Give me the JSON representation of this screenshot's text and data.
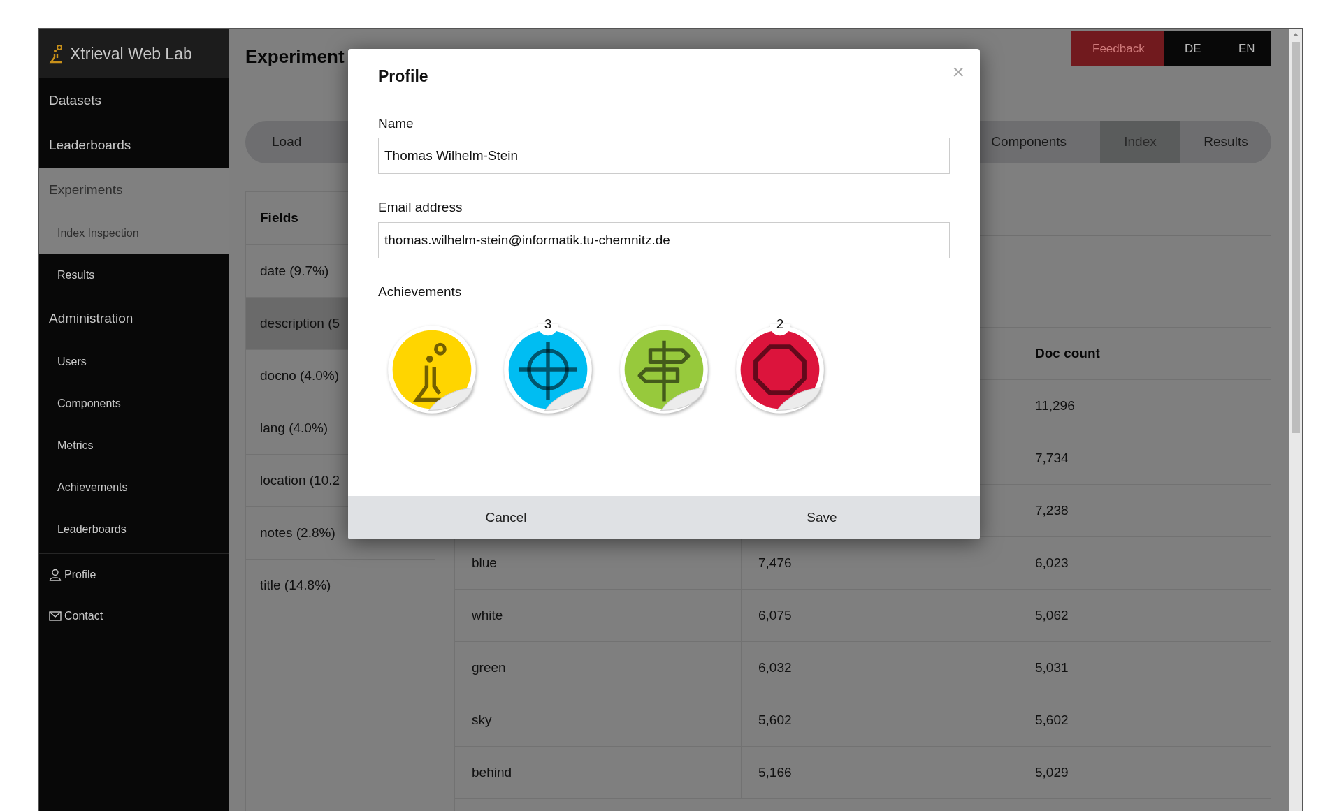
{
  "app": {
    "title": "Xtrieval Web Lab"
  },
  "sidebar": {
    "items": [
      {
        "label": "Datasets",
        "selected": false
      },
      {
        "label": "Leaderboards",
        "selected": false
      },
      {
        "label": "Experiments",
        "selected": true,
        "children": [
          {
            "label": "Index Inspection",
            "selected": true
          },
          {
            "label": "Results",
            "selected": false
          }
        ]
      },
      {
        "label": "Administration",
        "selected": false,
        "children": [
          {
            "label": "Users",
            "selected": false
          },
          {
            "label": "Components",
            "selected": false
          },
          {
            "label": "Metrics",
            "selected": false
          },
          {
            "label": "Achievements",
            "selected": false
          },
          {
            "label": "Leaderboards",
            "selected": false
          }
        ]
      }
    ],
    "links": [
      {
        "label": "Profile"
      },
      {
        "label": "Contact"
      }
    ]
  },
  "top_buttons": [
    {
      "label": "Feedback",
      "kind": "feedback"
    },
    {
      "label": "DE",
      "kind": "language"
    },
    {
      "label": "EN",
      "kind": "language"
    }
  ],
  "heading": "Experiment",
  "tabs": {
    "left": [
      {
        "label": "Load",
        "selected": false
      }
    ],
    "right": [
      {
        "label": "Components",
        "selected": false
      },
      {
        "label": "Index",
        "selected": true
      },
      {
        "label": "Results",
        "selected": false
      }
    ]
  },
  "fields": {
    "title": "Fields",
    "items": [
      {
        "label": "date (9.7%)",
        "selected": false
      },
      {
        "label": "description (5",
        "selected": true
      },
      {
        "label": "docno (4.0%)",
        "selected": false
      },
      {
        "label": "lang (4.0%)",
        "selected": false
      },
      {
        "label": "location (10.2",
        "selected": false
      },
      {
        "label": "notes (2.8%)",
        "selected": false
      },
      {
        "label": "title (14.8%)",
        "selected": false
      }
    ]
  },
  "table": {
    "column_3": "Doc count",
    "rows": [
      {
        "column_3": "11,296"
      },
      {
        "column_3": "7,734"
      },
      {
        "column_3": "7,238"
      },
      {
        "column_1": "blue",
        "column_2": "7,476",
        "column_3": "6,023"
      },
      {
        "column_1": "white",
        "column_2": "6,075",
        "column_3": "5,062"
      },
      {
        "column_1": "green",
        "column_2": "6,032",
        "column_3": "5,031"
      },
      {
        "column_1": "sky",
        "column_2": "5,602",
        "column_3": "5,602"
      },
      {
        "column_1": "behind",
        "column_2": "5,166",
        "column_3": "5,029"
      }
    ]
  },
  "modal": {
    "title": "Profile",
    "close": "×",
    "fields": [
      {
        "label": "Name",
        "value": "Thomas Wilhelm-Stein"
      },
      {
        "label": "Email address",
        "value": "thomas.wilhelm-stein@informatik.tu-chemnitz.de"
      }
    ],
    "achievements_label": "Achievements",
    "achievements": [
      {
        "kind": "flask",
        "color": "#ffd500"
      },
      {
        "kind": "target",
        "color": "#00bdf2",
        "count": "3"
      },
      {
        "kind": "signpost",
        "color": "#97c93c"
      },
      {
        "kind": "stop",
        "color": "#dc143c",
        "count": "2"
      }
    ],
    "buttons": [
      "Cancel",
      "Save"
    ]
  }
}
